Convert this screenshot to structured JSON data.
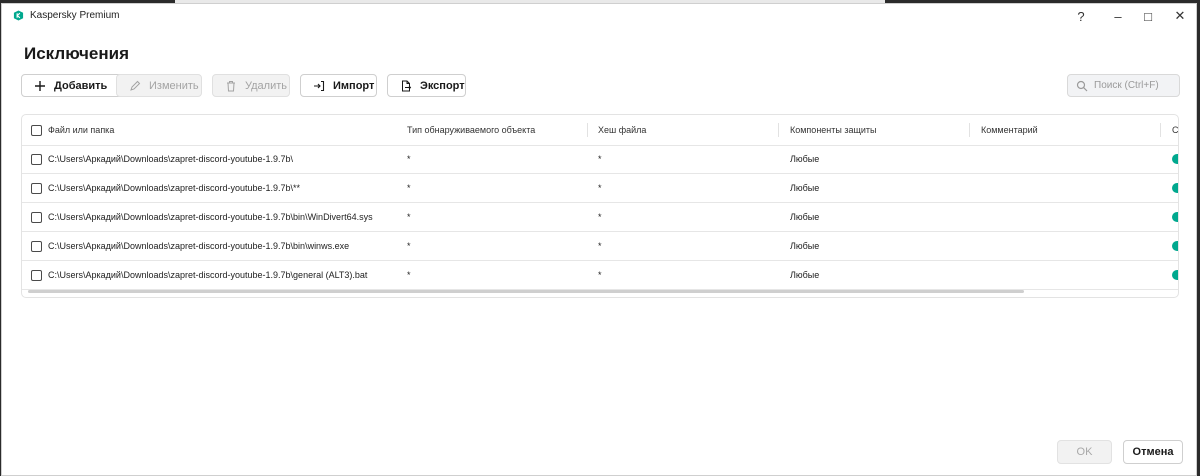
{
  "window": {
    "app_title": "Kaspersky Premium",
    "controls": {
      "help": "?",
      "minimize": "–",
      "maximize": "□",
      "close": "✕"
    }
  },
  "page_title": "Исключения",
  "toolbar": {
    "add_label": "Добавить",
    "edit_label": "Изменить",
    "delete_label": "Удалить",
    "import_label": "Импорт",
    "export_label": "Экспорт"
  },
  "search": {
    "placeholder": "Поиск (Ctrl+F)"
  },
  "table": {
    "columns": {
      "file": "Файл или папка",
      "type": "Тип обнаруживаемого объекта",
      "hash": "Хеш файла",
      "components": "Компоненты защиты",
      "comment": "Комментарий",
      "status": "Ст"
    },
    "rows": [
      {
        "path": "C:\\Users\\Аркадий\\Downloads\\zapret-discord-youtube-1.9.7b\\",
        "type": "*",
        "hash": "*",
        "components": "Любые",
        "comment": ""
      },
      {
        "path": "C:\\Users\\Аркадий\\Downloads\\zapret-discord-youtube-1.9.7b\\**",
        "type": "*",
        "hash": "*",
        "components": "Любые",
        "comment": ""
      },
      {
        "path": "C:\\Users\\Аркадий\\Downloads\\zapret-discord-youtube-1.9.7b\\bin\\WinDivert64.sys",
        "type": "*",
        "hash": "*",
        "components": "Любые",
        "comment": ""
      },
      {
        "path": "C:\\Users\\Аркадий\\Downloads\\zapret-discord-youtube-1.9.7b\\bin\\winws.exe",
        "type": "*",
        "hash": "*",
        "components": "Любые",
        "comment": ""
      },
      {
        "path": "C:\\Users\\Аркадий\\Downloads\\zapret-discord-youtube-1.9.7b\\general (ALT3).bat",
        "type": "*",
        "hash": "*",
        "components": "Любые",
        "comment": ""
      }
    ]
  },
  "footer": {
    "ok_label": "OK",
    "cancel_label": "Отмена"
  },
  "colors": {
    "accent": "#00a88e",
    "logo": "#00a88e"
  }
}
